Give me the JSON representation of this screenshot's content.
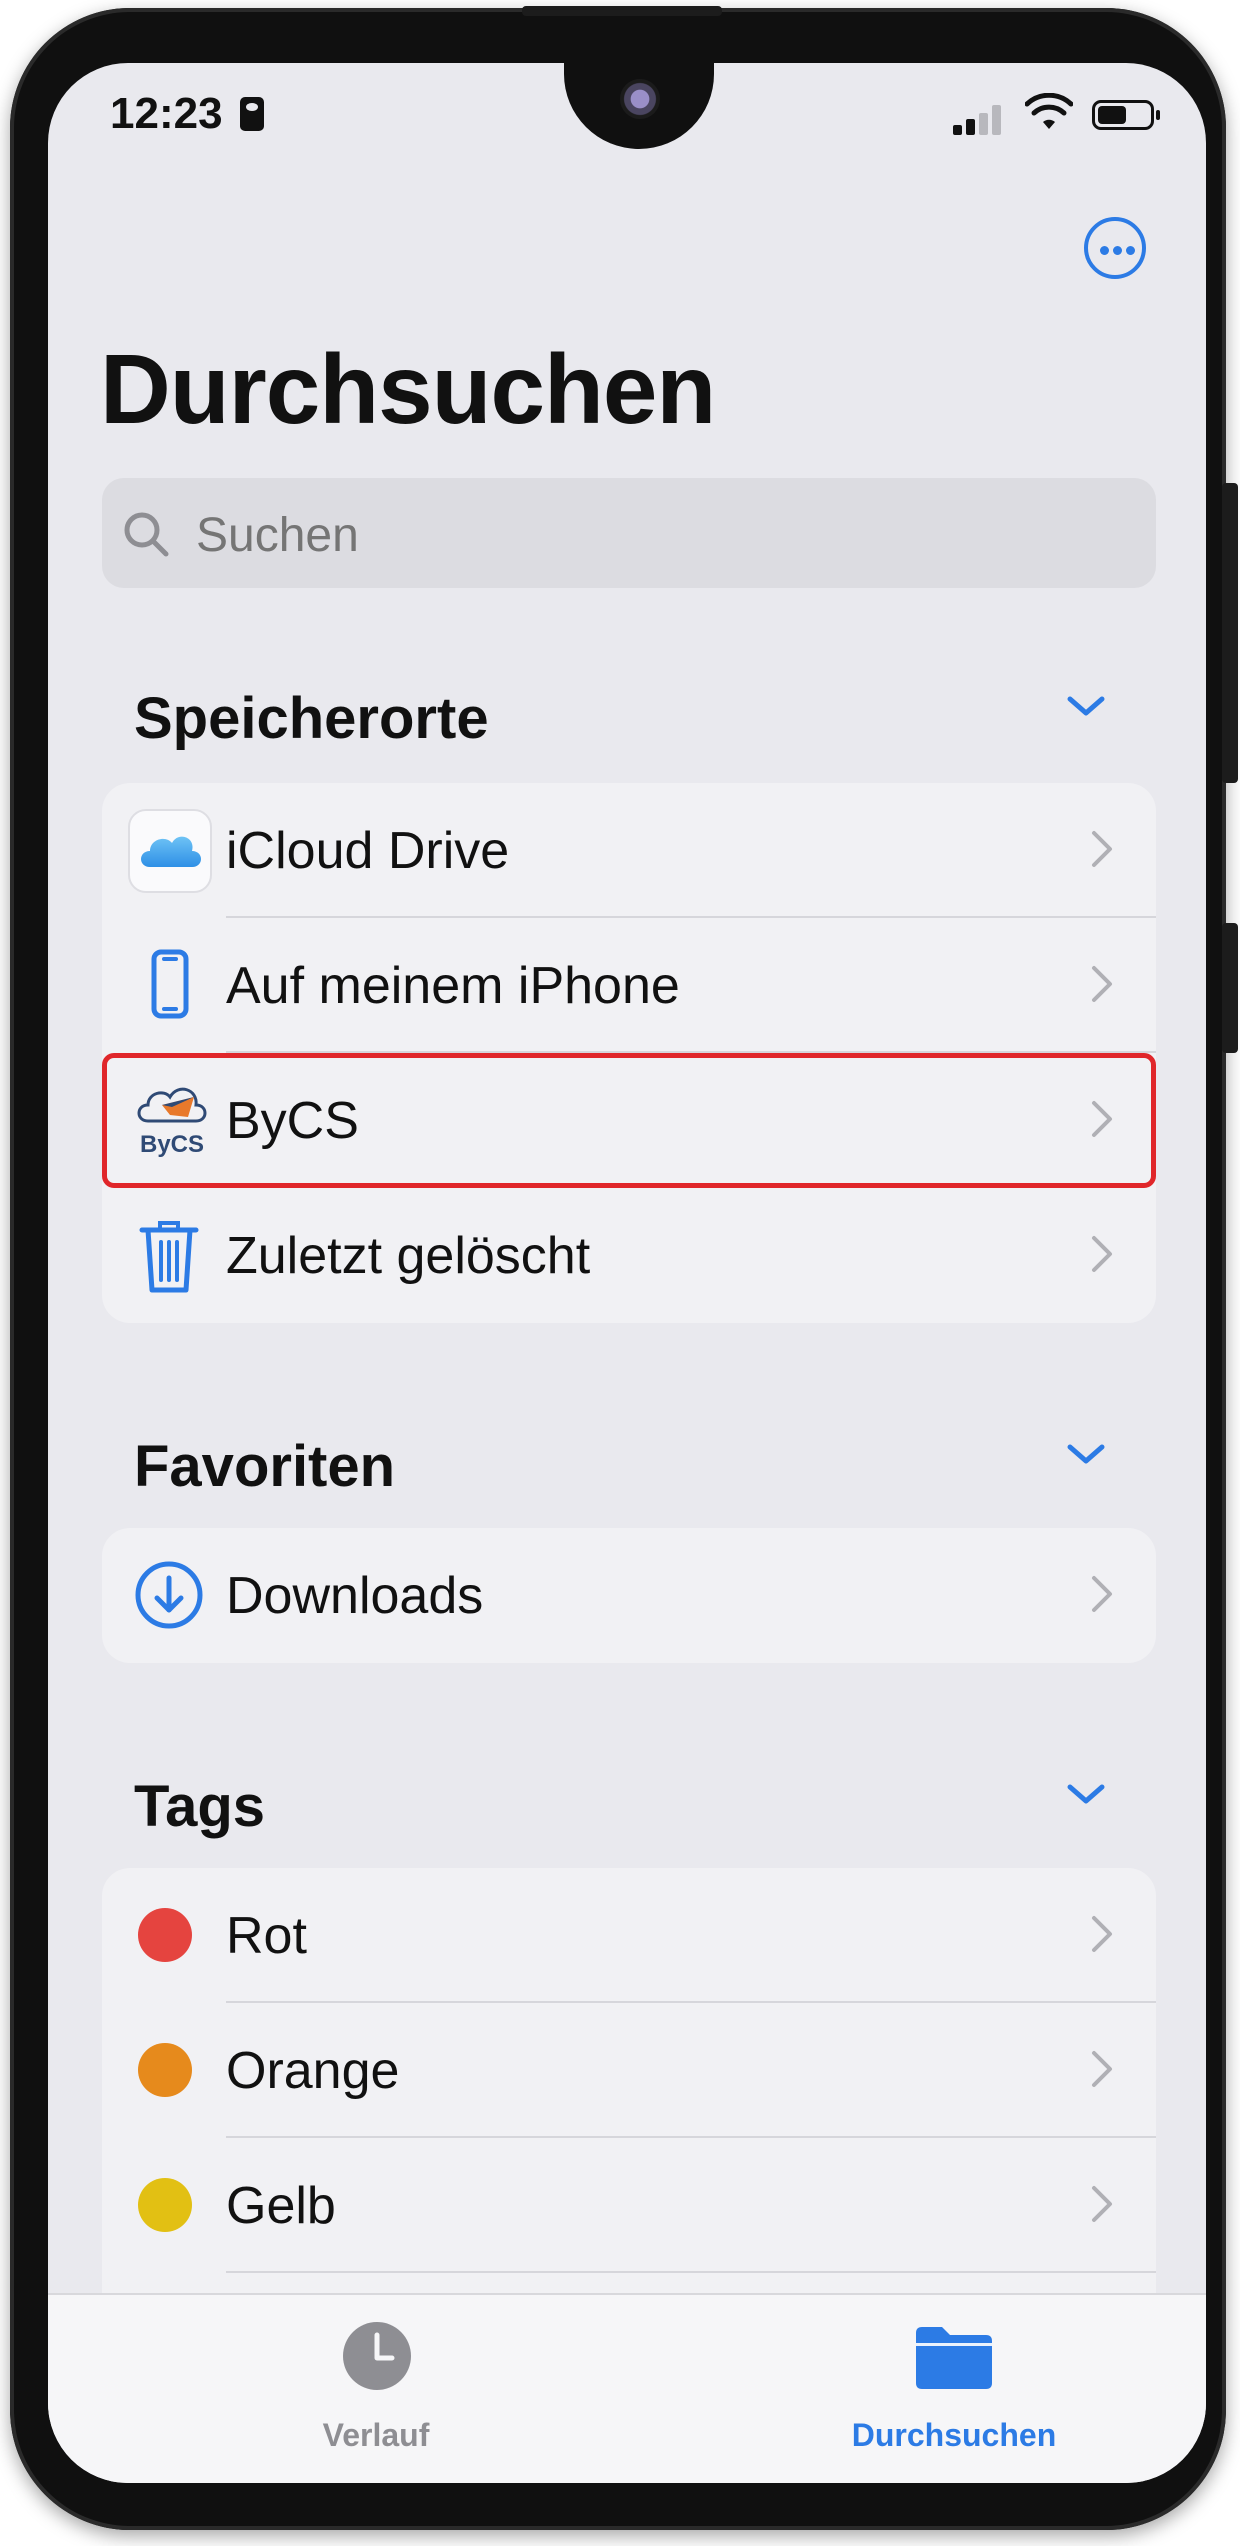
{
  "status": {
    "time": "12:23"
  },
  "header": {
    "title": "Durchsuchen"
  },
  "search": {
    "placeholder": "Suchen"
  },
  "sections": {
    "locations": {
      "title": "Speicherorte",
      "items": [
        {
          "label": "iCloud Drive",
          "icon": "icloud-icon"
        },
        {
          "label": "Auf meinem iPhone",
          "icon": "iphone-icon"
        },
        {
          "label": "ByCS",
          "icon": "bycs-logo-icon",
          "logo_text": "ByCS",
          "highlighted": true
        },
        {
          "label": "Zuletzt gelöscht",
          "icon": "trash-icon"
        }
      ]
    },
    "favorites": {
      "title": "Favoriten",
      "items": [
        {
          "label": "Downloads",
          "icon": "download-icon"
        }
      ]
    },
    "tags": {
      "title": "Tags",
      "items": [
        {
          "label": "Rot",
          "color": "#e5443f"
        },
        {
          "label": "Orange",
          "color": "#e68a1c"
        },
        {
          "label": "Gelb",
          "color": "#e2c013"
        }
      ]
    }
  },
  "tabbar": {
    "tabs": [
      {
        "label": "Verlauf",
        "icon": "clock-icon",
        "active": false
      },
      {
        "label": "Durchsuchen",
        "icon": "folder-icon",
        "active": true
      }
    ]
  },
  "colors": {
    "accent": "#2c7be5",
    "highlight_border": "#e0262a",
    "inactive_tab": "#8e8e93"
  }
}
